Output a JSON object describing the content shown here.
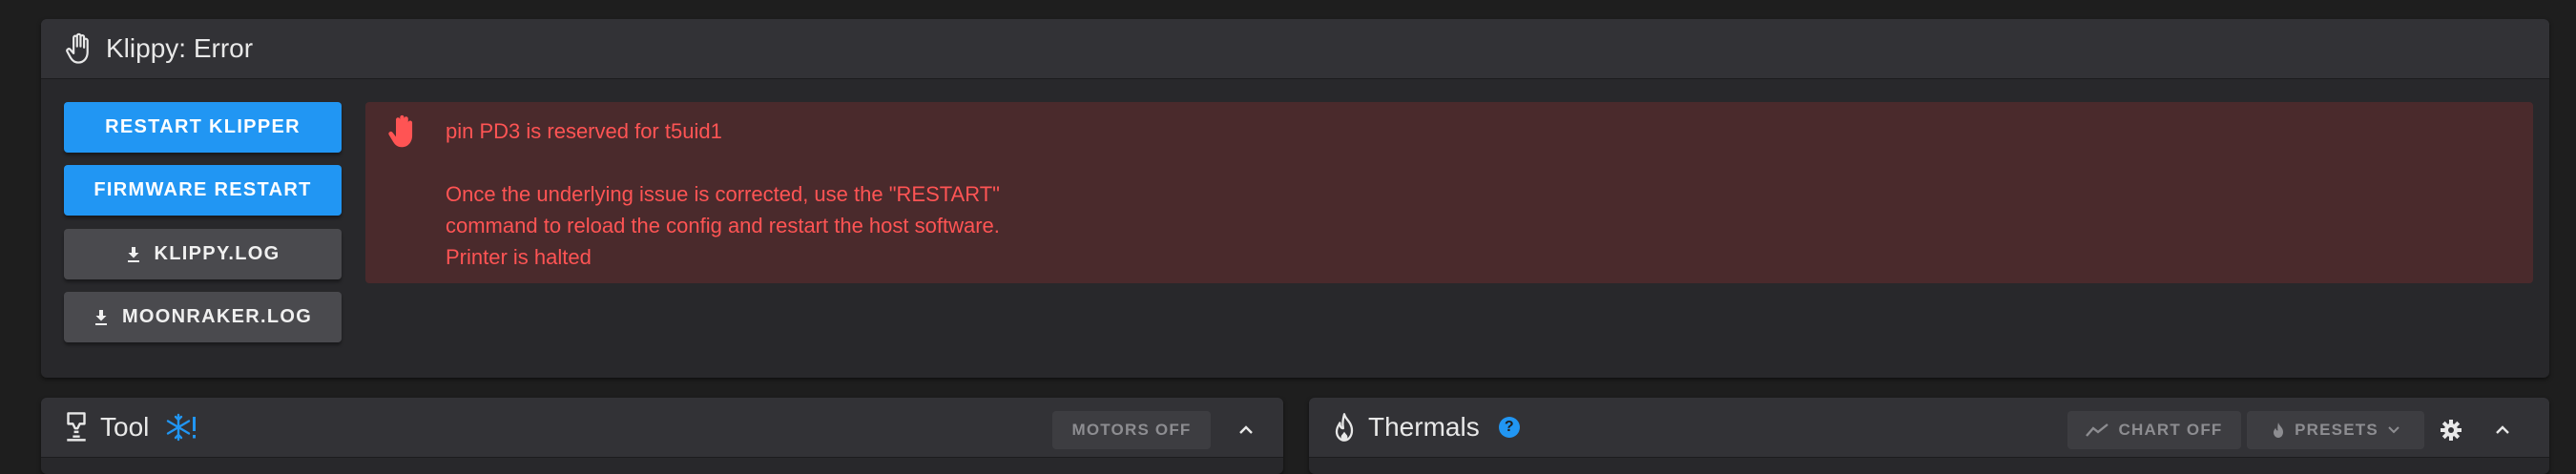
{
  "error_panel": {
    "title": "Klippy: Error",
    "buttons": [
      {
        "label": "RESTART KLIPPER",
        "icon": ""
      },
      {
        "label": "FIRMWARE RESTART",
        "icon": ""
      },
      {
        "label": "KLIPPY.LOG",
        "icon": "download-icon"
      },
      {
        "label": "MOONRAKER.LOG",
        "icon": "download-icon"
      }
    ],
    "message_lines": [
      "pin PD3 is reserved for t5uid1",
      "",
      "Once the underlying issue is corrected, use the \"RESTART\"",
      "command to reload the config and restart the host software.",
      "Printer is halted"
    ],
    "message_color": "#ff5454",
    "alert_icon": "hand-stop-icon"
  },
  "tool_panel": {
    "title": "Tool",
    "motors_off_label": "MOTORS OFF",
    "title_icon": "printer-nozzle-icon",
    "status_icon": "snowflake-alert-icon"
  },
  "thermals_panel": {
    "title": "Thermals",
    "info_badge": "?",
    "chart_toggle_label": "CHART OFF",
    "presets_label": "PRESETS",
    "title_icon": "fire-icon"
  },
  "colors": {
    "primary": "#2196f3",
    "error_text": "#ff5454",
    "error_bg": "#4a2a2c",
    "panel_bg": "#28282b",
    "header_bg": "#323236"
  }
}
